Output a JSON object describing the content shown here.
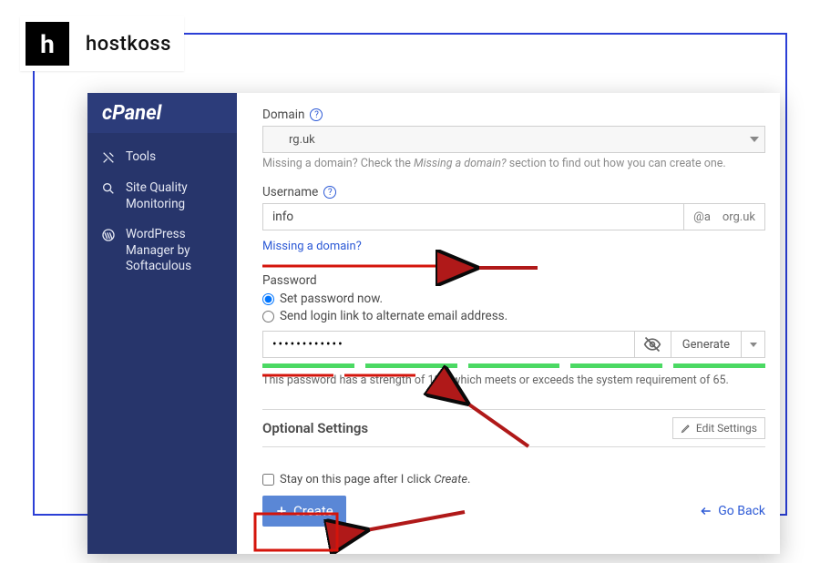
{
  "header": {
    "badge_letter": "h",
    "badge_name": "hostkoss",
    "cpanel_logo": "cPanel"
  },
  "sidebar": {
    "items": [
      {
        "icon": "tools-icon",
        "label": "Tools"
      },
      {
        "icon": "search-quality-icon",
        "label": "Site Quality Monitoring"
      },
      {
        "icon": "wordpress-icon",
        "label": "WordPress Manager by Softaculous"
      }
    ]
  },
  "form": {
    "domain_label": "Domain",
    "domain_value": "rg.uk",
    "domain_hint_prefix": "Missing a domain? Check the ",
    "domain_hint_em": "Missing a domain?",
    "domain_hint_suffix": " section to find out how you can create one.",
    "username_label": "Username",
    "username_value": "info",
    "username_suffix_at": "@a",
    "username_suffix_domain": "org.uk",
    "missing_link": "Missing a domain?",
    "password_label": "Password",
    "password_option_now": "Set password now.",
    "password_option_link": "Send login link to alternate email address.",
    "password_value": "••••••••••••",
    "generate_label": "Generate",
    "strength_text": "This password has a strength of 100, which meets or exceeds the system requirement of 65.",
    "optional_title": "Optional Settings",
    "edit_settings": "Edit Settings",
    "stay_text_prefix": "Stay on this page after I click ",
    "stay_text_em": "Create",
    "stay_text_suffix": ".",
    "create_label": "Create",
    "go_back": "Go Back"
  }
}
